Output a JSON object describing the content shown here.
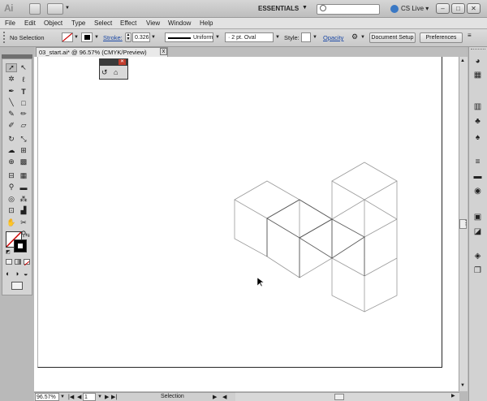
{
  "app": {
    "logo": "Ai",
    "workspace": "ESSENTIALS",
    "cs_live": "CS Live"
  },
  "menu": [
    "File",
    "Edit",
    "Object",
    "Type",
    "Select",
    "Effect",
    "View",
    "Window",
    "Help"
  ],
  "control_bar": {
    "selection": "No Selection",
    "stroke_label": "Stroke:",
    "stroke_weight": "0.326",
    "stroke_profile": "Uniform",
    "brush": "2 pt. Oval",
    "style_label": "Style:",
    "opacity_label": "Opacity",
    "document_setup": "Document Setup",
    "preferences": "Preferences"
  },
  "document": {
    "tab_title": "03_start.ai* @ 96.57% (CMYK/Preview)",
    "close_glyph": "x"
  },
  "status": {
    "zoom": "96.57%",
    "artboard": "1",
    "tool": "Selection"
  },
  "colors": {
    "fill": "#ffffff",
    "stroke": "#000000",
    "accent_link": "#1c49a6"
  },
  "icons": {
    "tools": [
      "selection-tool-icon",
      "direct-selection-tool-icon",
      "magic-wand-tool-icon",
      "lasso-tool-icon",
      "pen-tool-icon",
      "type-tool-icon",
      "line-tool-icon",
      "rectangle-tool-icon",
      "paintbrush-tool-icon",
      "pencil-tool-icon",
      "blob-brush-tool-icon",
      "eraser-tool-icon",
      "rotate-tool-icon",
      "scale-tool-icon",
      "warp-tool-icon",
      "free-transform-tool-icon",
      "shape-builder-tool-icon",
      "live-paint-tool-icon",
      "perspective-grid-tool-icon",
      "mesh-tool-icon",
      "gradient-tool-icon",
      "eyedropper-tool-icon",
      "blend-tool-icon",
      "symbol-sprayer-tool-icon",
      "column-graph-tool-icon",
      "artboard-tool-icon",
      "slice-tool-icon",
      "hand-tool-icon",
      "zoom-tool-icon"
    ],
    "dock": [
      "color-panel-icon",
      "color-guide-icon",
      "swatches-icon",
      "brushes-icon",
      "symbols-icon",
      "stroke-panel-icon",
      "gradient-panel-icon",
      "transparency-panel-icon",
      "appearance-panel-icon",
      "graphic-styles-icon",
      "layers-panel-icon",
      "artboards-panel-icon"
    ]
  }
}
